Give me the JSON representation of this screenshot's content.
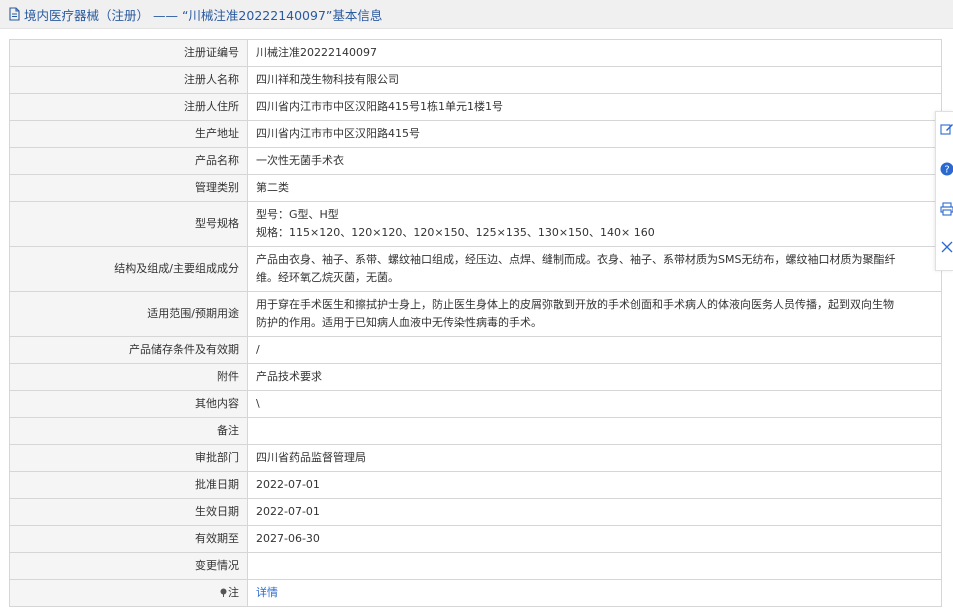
{
  "header": {
    "title": "境内医疗器械（注册） —— “川械注准20222140097”基本信息",
    "icon": "document-icon"
  },
  "rows": [
    {
      "label": "注册证编号",
      "lines": [
        "川械注准20222140097"
      ]
    },
    {
      "label": "注册人名称",
      "lines": [
        "四川祥和茂生物科技有限公司"
      ]
    },
    {
      "label": "注册人住所",
      "lines": [
        "四川省内江市市中区汉阳路415号1栋1单元1楼1号"
      ]
    },
    {
      "label": "生产地址",
      "lines": [
        "四川省内江市市中区汉阳路415号"
      ]
    },
    {
      "label": "产品名称",
      "lines": [
        "一次性无菌手术衣"
      ]
    },
    {
      "label": "管理类别",
      "lines": [
        "第二类"
      ]
    },
    {
      "label": "型号规格",
      "lines": [
        "型号：G型、H型",
        "规格：115×120、120×120、120×150、125×135、130×150、140× 160"
      ]
    },
    {
      "label": "结构及组成/主要组成成分",
      "lines": [
        "产品由衣身、袖子、系带、螺纹袖口组成，经压边、点焊、缝制而成。衣身、袖子、系带材质为SMS无纺布，螺纹袖口材质为聚酯纤",
        "维。经环氧乙烷灭菌，无菌。"
      ]
    },
    {
      "label": "适用范围/预期用途",
      "lines": [
        "用于穿在手术医生和擦拭护士身上，防止医生身体上的皮屑弥散到开放的手术创面和手术病人的体液向医务人员传播，起到双向生物",
        "防护的作用。适用于已知病人血液中无传染性病毒的手术。"
      ]
    },
    {
      "label": "产品储存条件及有效期",
      "lines": [
        "/"
      ]
    },
    {
      "label": "附件",
      "lines": [
        "产品技术要求"
      ]
    },
    {
      "label": "其他内容",
      "lines": [
        "\\"
      ]
    },
    {
      "label": "备注",
      "lines": [
        ""
      ]
    },
    {
      "label": "审批部门",
      "lines": [
        "四川省药品监督管理局"
      ]
    },
    {
      "label": "批准日期",
      "lines": [
        "2022-07-01"
      ]
    },
    {
      "label": "生效日期",
      "lines": [
        "2022-07-01"
      ]
    },
    {
      "label": "有效期至",
      "lines": [
        "2027-06-30"
      ]
    },
    {
      "label": "变更情况",
      "lines": [
        ""
      ]
    }
  ],
  "note_row": {
    "label": "注",
    "link_text": "详情",
    "icon": "pin-icon"
  },
  "side_tools": [
    {
      "icon": "edit-icon"
    },
    {
      "icon": "help-icon"
    },
    {
      "icon": "print-icon"
    },
    {
      "icon": "close-icon"
    }
  ],
  "colors": {
    "title": "#2a5aa0",
    "link": "#2a6ad0",
    "label_bg": "#f5f5f5",
    "border": "#d6d6d6"
  }
}
